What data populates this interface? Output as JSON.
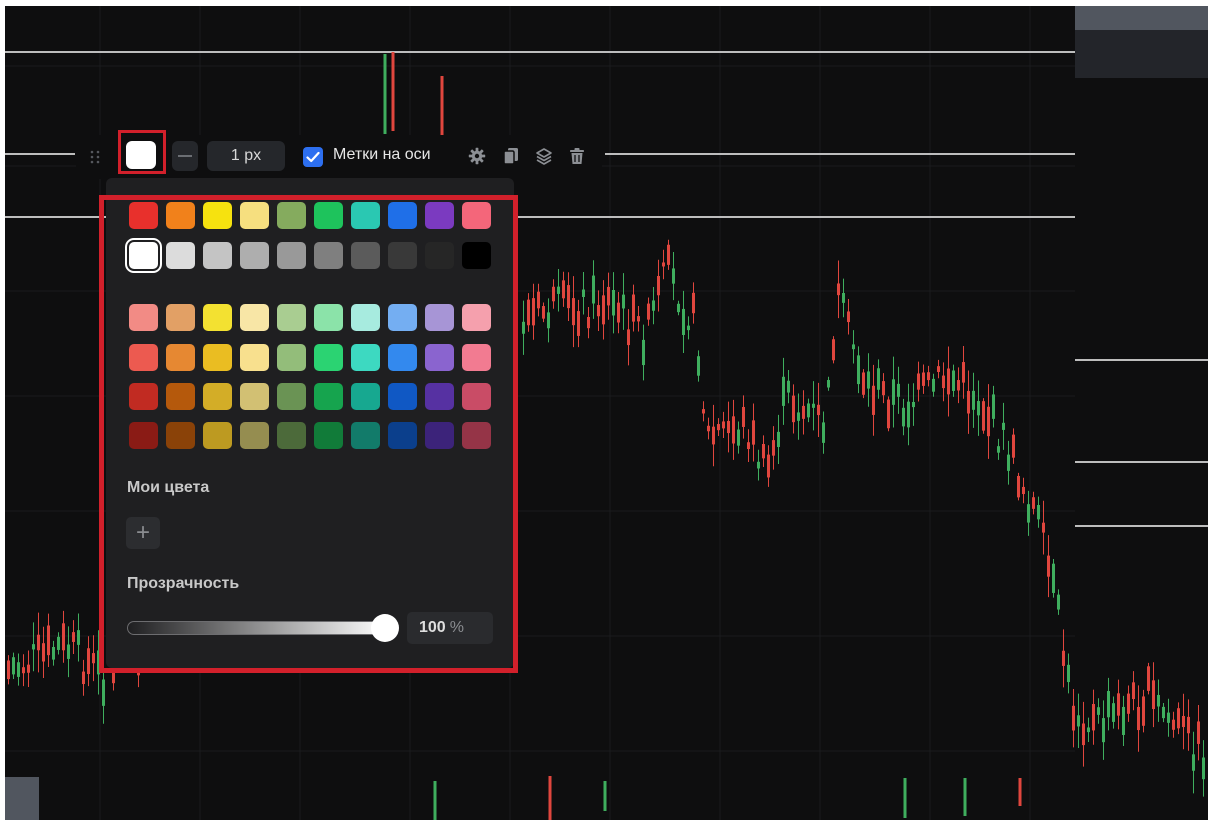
{
  "toolbar": {
    "selected_color": "#ffffff",
    "line_width": "1 px",
    "axis_labels_checked": true,
    "axis_labels_text": "Метки на оси",
    "icons": [
      "drag-handle-icon",
      "settings-gear-icon",
      "copy-icon",
      "layers-icon",
      "trash-icon"
    ]
  },
  "color_picker": {
    "palette_rows": [
      [
        "#e8302c",
        "#f1811b",
        "#f6e20f",
        "#f6df7f",
        "#85ab5e",
        "#1ec35c",
        "#2ac8b2",
        "#1f6fe8",
        "#7b3ac0",
        "#f4667a"
      ],
      [
        "#ffffff",
        "#dcdcdc",
        "#c4c4c4",
        "#aeaeae",
        "#999999",
        "#7f7f7f",
        "#5b5b5b",
        "#393939",
        "#262626",
        "#000000"
      ],
      [
        "#f28b85",
        "#e2a065",
        "#f3e131",
        "#f8e6a6",
        "#a9cd91",
        "#8be3a9",
        "#a7ebdf",
        "#74aef2",
        "#a795d6",
        "#f5a0ad"
      ],
      [
        "#ec5a50",
        "#e68832",
        "#eabd22",
        "#f8e08e",
        "#93bd7a",
        "#2bd372",
        "#3dd9c1",
        "#3389ee",
        "#8a64cf",
        "#f27b91"
      ],
      [
        "#c12b22",
        "#b5590c",
        "#d3ad27",
        "#d2c073",
        "#6a9354",
        "#16a44e",
        "#17a890",
        "#1058c4",
        "#5631a2",
        "#c94c66"
      ],
      [
        "#8a1b15",
        "#8a4208",
        "#bd9a21",
        "#958d50",
        "#4c6a3a",
        "#117b39",
        "#127b6a",
        "#0b3f8c",
        "#3c237a",
        "#953447"
      ]
    ],
    "selected_swatch": "#ffffff",
    "my_colors_label": "Мои цвета",
    "add_color_symbol": "+",
    "transparency_label": "Прозрачность",
    "opacity_value": "100",
    "opacity_unit": "%",
    "opacity_fraction": 1.0
  },
  "colors": {
    "background": "#0e0e0f",
    "popup_bg": "#1f1f21",
    "highlight_frame": "#d2202b",
    "candle_up": "#3fae5e",
    "candle_down": "#e0463e",
    "checkbox_accent": "#2d6ff0"
  }
}
